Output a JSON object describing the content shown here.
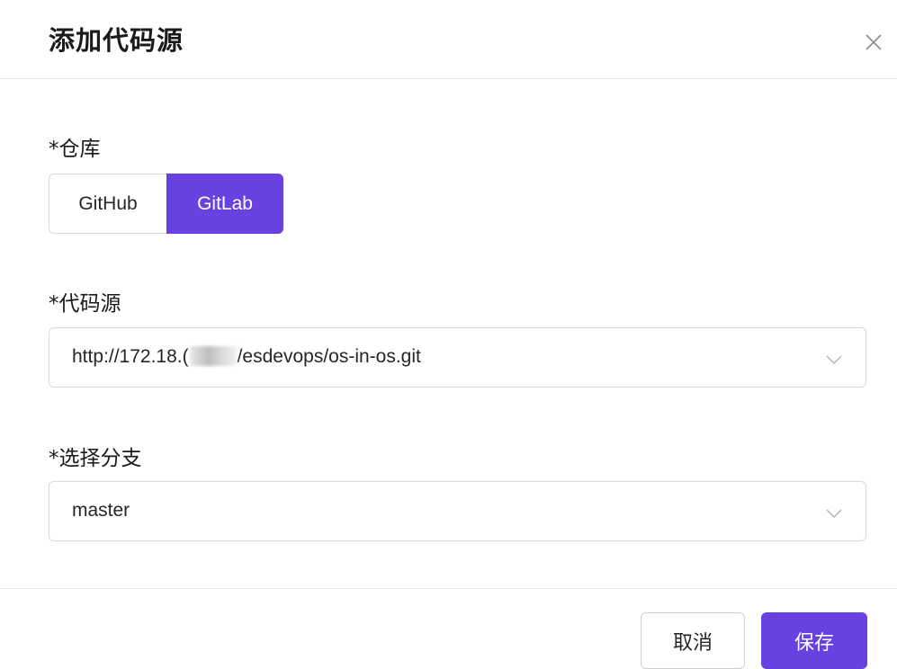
{
  "dialog": {
    "title": "添加代码源",
    "close_icon": "close-icon"
  },
  "repository": {
    "label": "*仓库",
    "options": [
      "GitHub",
      "GitLab"
    ],
    "selected": "GitLab",
    "accent_color": "#6941e0"
  },
  "code_source": {
    "label": "*代码源",
    "value_prefix": "http://172.18.(",
    "value_suffix": "/esdevops/os-in-os.git",
    "icon": "chevron-down-icon"
  },
  "branch": {
    "label": "*选择分支",
    "value": "master",
    "icon": "chevron-down-icon"
  },
  "footer": {
    "cancel_label": "取消",
    "save_label": "保存"
  }
}
